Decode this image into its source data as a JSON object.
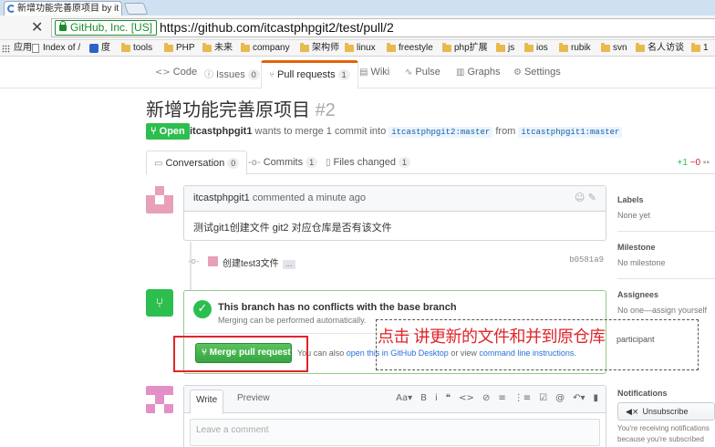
{
  "browser": {
    "tab_title": "新增功能完善原项目 by it",
    "ev_label": "GitHub, Inc. [US]",
    "url": "https://github.com/itcastphpgit2/test/pull/2",
    "bookmarks": [
      "应用",
      "Index of /",
      "度",
      "tools",
      "PHP",
      "未来",
      "company",
      "架构师",
      "linux",
      "freestyle",
      "php扩展",
      "js",
      "ios",
      "rubik",
      "svn",
      "名人访谈",
      "1"
    ]
  },
  "repo_nav": {
    "code": "Code",
    "issues": "Issues",
    "issues_count": "0",
    "pulls": "Pull requests",
    "pulls_count": "1",
    "wiki": "Wiki",
    "pulse": "Pulse",
    "graphs": "Graphs",
    "settings": "Settings"
  },
  "pr": {
    "title": "新增功能完善原项目",
    "number": "#2",
    "state": "Open",
    "author": "itcastphpgit1",
    "merge_text": "wants to merge 1 commit into",
    "base_branch": "itcastphpgit2:master",
    "from_text": "from",
    "head_branch": "itcastphpgit1:master"
  },
  "pr_tabs": {
    "conversation": "Conversation",
    "conversation_count": "0",
    "commits": "Commits",
    "commits_count": "1",
    "files": "Files changed",
    "files_count": "1",
    "additions": "+1",
    "deletions": "−0"
  },
  "comment": {
    "author": "itcastphpgit1",
    "action": "commented",
    "time": "a minute ago",
    "body": "测试git1创建文件 git2 对应仓库是否有该文件"
  },
  "commit": {
    "message": "创建test3文件",
    "ellipsis": "…",
    "sha": "b0581a9"
  },
  "merge": {
    "title": "This branch has no conflicts with the base branch",
    "subtitle": "Merging can be performed automatically.",
    "button": "Merge pull request",
    "hint_prefix": "You can also",
    "hint_link1": "open this in GitHub Desktop",
    "hint_mid": "or view",
    "hint_link2": "command line instructions",
    "hint_suffix": "."
  },
  "annotation": {
    "text": "点击   讲更新的文件和并到原仓库",
    "behind_text": "participant"
  },
  "editor": {
    "write_tab": "Write",
    "preview_tab": "Preview",
    "placeholder": "Leave a comment"
  },
  "sidebar": {
    "labels_h": "Labels",
    "labels_v": "None yet",
    "milestone_h": "Milestone",
    "milestone_v": "No milestone",
    "assignees_h": "Assignees",
    "assignees_v": "No one—assign yourself",
    "notifications_h": "Notifications",
    "unsubscribe": "Unsubscribe",
    "notif_text": "You're receiving notifications because you're subscribed"
  }
}
